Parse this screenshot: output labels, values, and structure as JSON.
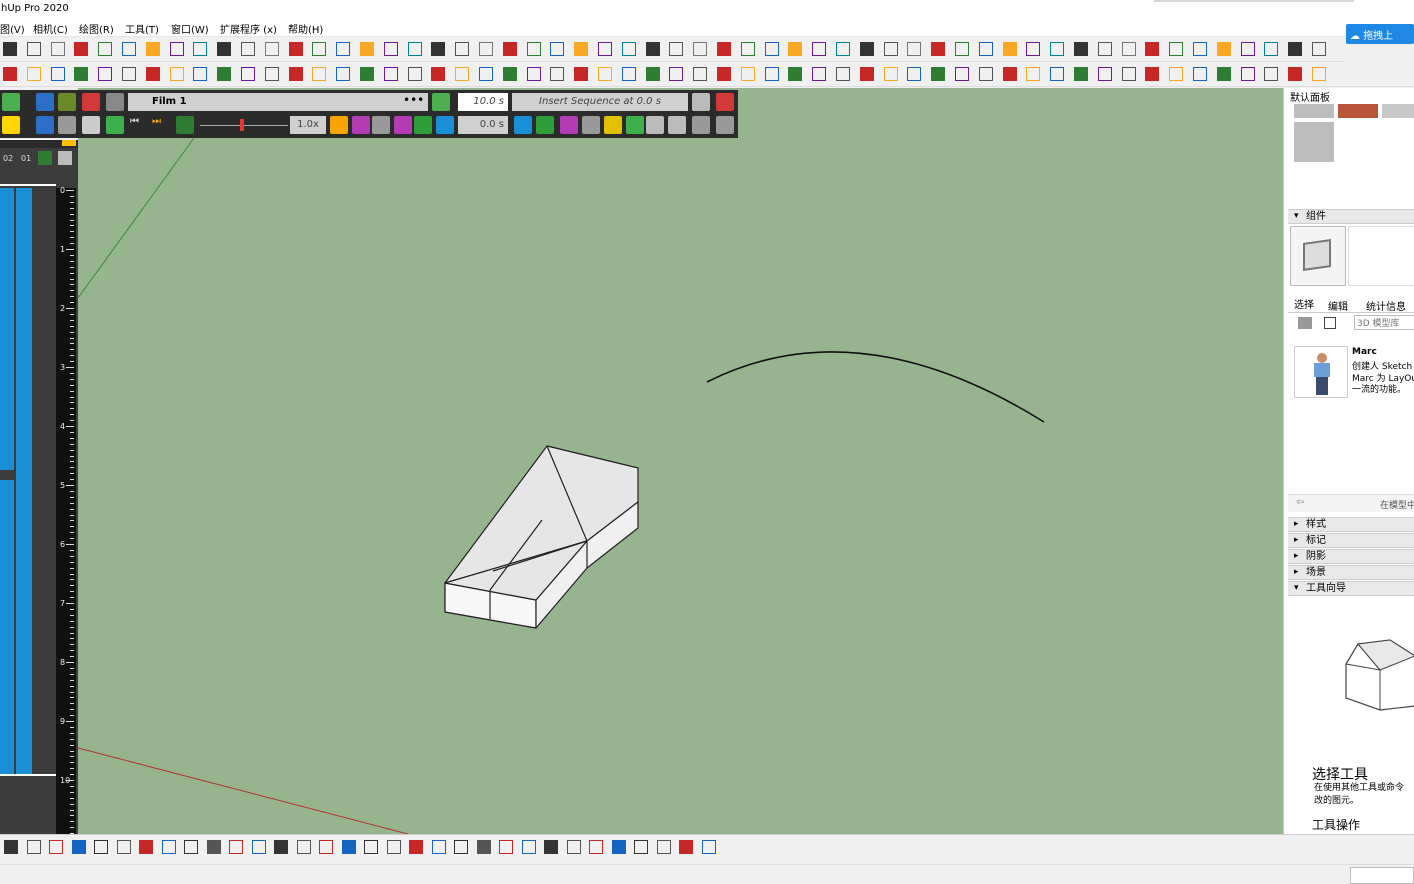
{
  "window": {
    "title": "hUp Pro 2020"
  },
  "menu": [
    "图(V)",
    "相机(C)",
    "绘图(R)",
    "工具(T)",
    "窗口(W)",
    "扩展程序 (x)",
    "帮助(H)"
  ],
  "cloud_button": "拖拽上",
  "animation": {
    "film_label": "Film 1",
    "duration": "10.0 s",
    "insert_sequence": "Insert Sequence at 0.0 s",
    "speed": "1.0x",
    "time": "0.0 s"
  },
  "timeline": {
    "col_labels": [
      "02",
      "01"
    ],
    "ruler": [
      "0",
      "1",
      "2",
      "3",
      "4",
      "5",
      "6",
      "7",
      "8",
      "9",
      "10"
    ]
  },
  "right_panel": {
    "materials_title": "默认面板",
    "components_title": "组件",
    "tabs": [
      "选择",
      "编辑",
      "统计信息"
    ],
    "search_placeholder": "3D 模型库",
    "component_author": "Marc",
    "component_desc": [
      "创建人 Sketch",
      "Marc 为 LayOu",
      "一流的功能。"
    ],
    "in_model": "在模型中",
    "sections": [
      "样式",
      "标记",
      "阴影",
      "场景",
      "工具向导"
    ],
    "tool_title": "选择工具",
    "tool_desc": [
      "在使用其他工具或命令",
      "改的图元。"
    ],
    "tool_ops": "工具操作"
  },
  "colors": {
    "viewport": "#96b58e",
    "accent": "#1b8fd6"
  }
}
